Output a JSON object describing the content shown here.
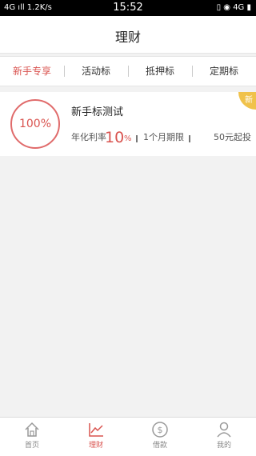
{
  "status": {
    "left": "4G ıll  1.2K/s",
    "time": "15:52",
    "right": "▯ ◉ 4G ▮"
  },
  "header": {
    "title": "理财"
  },
  "tabs": [
    {
      "label": "新手专享",
      "active": true
    },
    {
      "label": "活动标",
      "active": false
    },
    {
      "label": "抵押标",
      "active": false
    },
    {
      "label": "定期标",
      "active": false
    }
  ],
  "product": {
    "progress": "100%",
    "name": "新手标测试",
    "rate_label": "年化利率",
    "rate_value": "10",
    "rate_unit": "%",
    "term": "1个月期限",
    "min_invest": "50元起投",
    "corner_badge": "新"
  },
  "colors": {
    "accent": "#d9534f",
    "badge": "#f0c24b"
  },
  "bottom_nav": [
    {
      "label": "首页",
      "icon": "home-icon",
      "active": false
    },
    {
      "label": "理财",
      "icon": "chart-icon",
      "active": true
    },
    {
      "label": "借款",
      "icon": "dollar-circle-icon",
      "active": false
    },
    {
      "label": "我的",
      "icon": "user-icon",
      "active": false
    }
  ]
}
